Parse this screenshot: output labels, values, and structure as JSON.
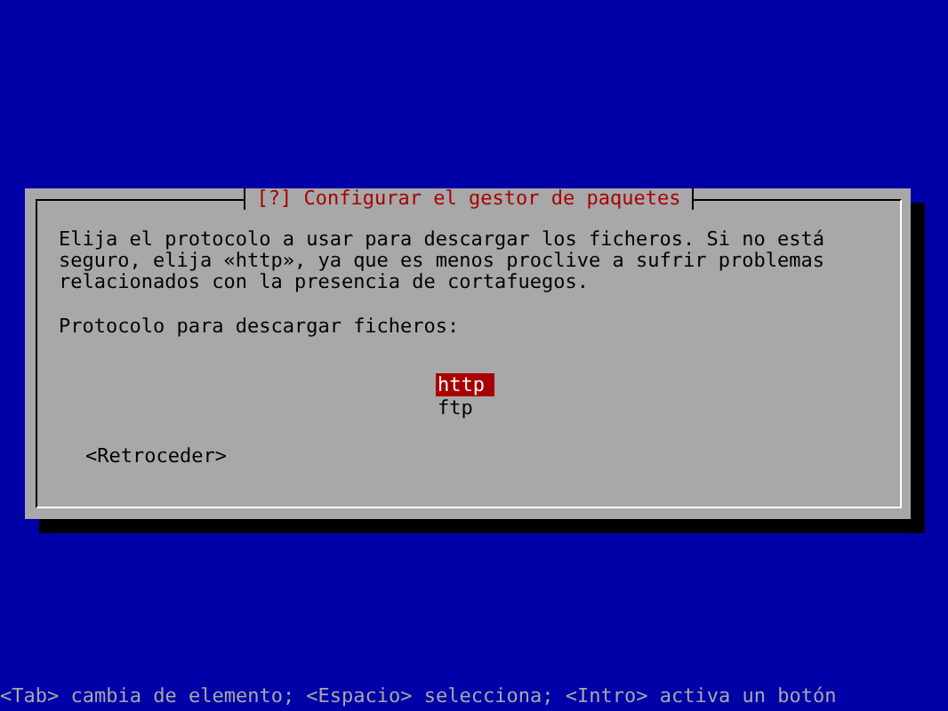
{
  "dialog": {
    "title": "[?] Configurar el gestor de paquetes",
    "description": "Elija el protocolo a usar para descargar los ficheros. Si no está seguro, elija «http», ya que es menos proclive a sufrir problemas relacionados con la presencia de cortafuegos.",
    "prompt": "Protocolo para descargar ficheros:",
    "options": [
      {
        "label": "http",
        "selected": true
      },
      {
        "label": "ftp",
        "selected": false
      }
    ],
    "back_button": "<Retroceder>"
  },
  "status_bar": "<Tab> cambia de elemento; <Espacio> selecciona; <Intro> activa un botón"
}
